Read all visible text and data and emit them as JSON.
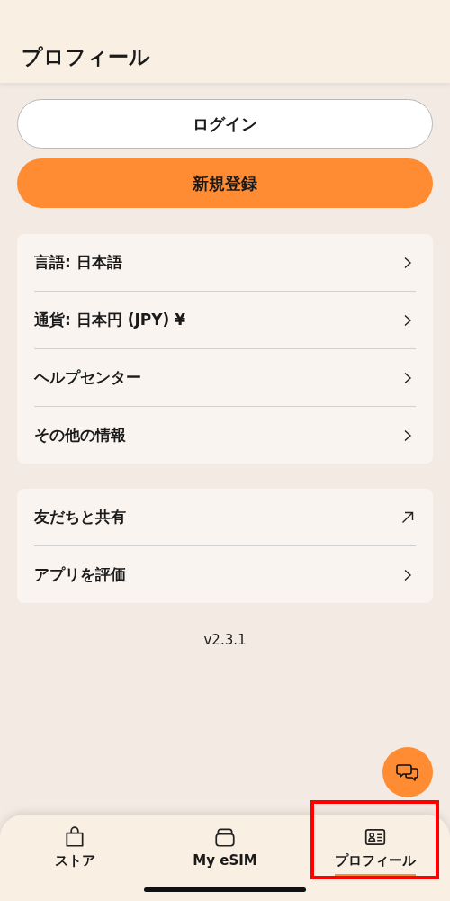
{
  "header": {
    "title": "プロフィール"
  },
  "auth_buttons": [
    {
      "label": "ログイン",
      "kind": "outline"
    },
    {
      "label": "新規登録",
      "kind": "filled"
    }
  ],
  "menu_groups": [
    {
      "items": [
        {
          "label": "言語: 日本語",
          "kind": "chevron"
        },
        {
          "label": "通貨: 日本円 (JPY) ¥",
          "kind": "chevron"
        },
        {
          "label": "ヘルプセンター",
          "kind": "chevron"
        },
        {
          "label": "その他の情報",
          "kind": "chevron"
        }
      ]
    },
    {
      "items": [
        {
          "label": "友だちと共有",
          "kind": "external"
        },
        {
          "label": "アプリを評価",
          "kind": "chevron"
        }
      ]
    }
  ],
  "version": "v2.3.1",
  "tab_bar": {
    "items": [
      {
        "label": "ストア",
        "kind": "bag",
        "selected": false,
        "highlighted": false
      },
      {
        "label": "My eSIM",
        "kind": "sim",
        "selected": false,
        "highlighted": false
      },
      {
        "label": "プロフィール",
        "kind": "id-card",
        "selected": true,
        "highlighted": true
      }
    ]
  }
}
